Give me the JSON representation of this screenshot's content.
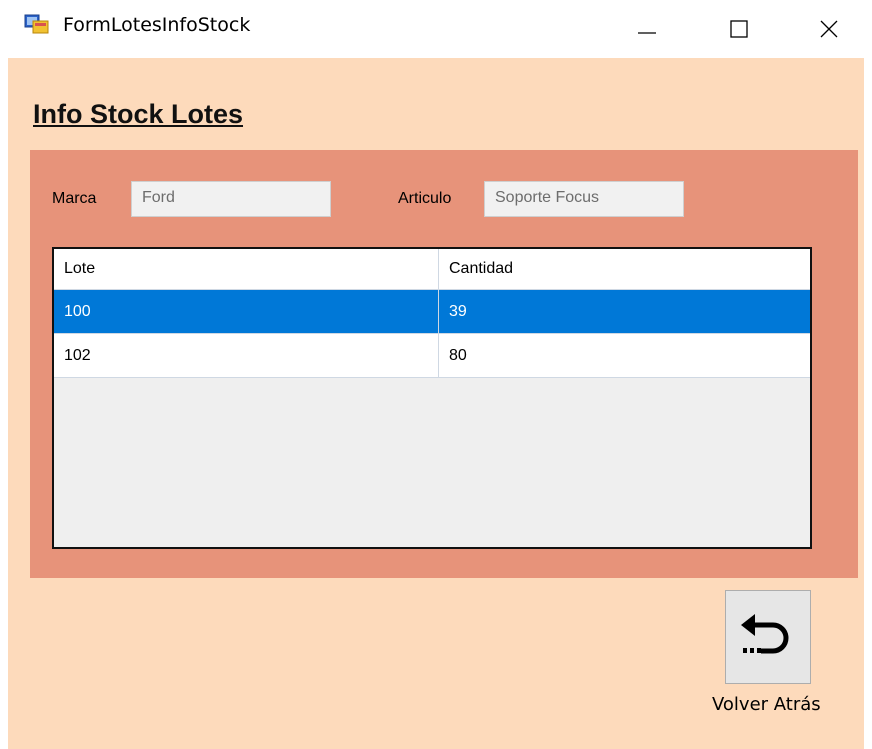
{
  "window": {
    "title": "FormLotesInfoStock"
  },
  "page_title": "Info Stock Lotes",
  "filters": {
    "marca_label": "Marca",
    "marca_value": "Ford",
    "articulo_label": "Articulo",
    "articulo_value": "Soporte Focus"
  },
  "grid": {
    "columns": [
      "Lote",
      "Cantidad"
    ],
    "rows": [
      {
        "lote": "100",
        "cantidad": "39",
        "selected": true
      },
      {
        "lote": "102",
        "cantidad": "80",
        "selected": false
      }
    ]
  },
  "actions": {
    "back_label": "Volver Atrás",
    "back_icon": "return-arrow-icon"
  },
  "colors": {
    "form_background": "#fddabb",
    "panel_background": "#e7937a",
    "selection": "#0078d7"
  }
}
